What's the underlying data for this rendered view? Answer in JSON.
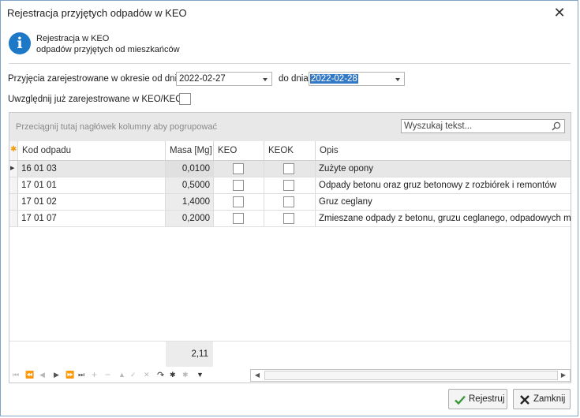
{
  "window": {
    "title": "Rejestracja przyjętych odpadów w KEO",
    "close_label": "✕"
  },
  "info": {
    "line1": "Rejestracja w KEO",
    "line2": "odpadów przyjętych od mieszkańców"
  },
  "filter": {
    "from_label": "Przyjęcia zarejestrowane w okresie od dnia",
    "from_value": "2022-02-27",
    "to_label": "do dnia",
    "to_value": "2022-02-28",
    "include_label": "Uwzględnij już zarejestrowane w KEO/KEOK",
    "include_checked": false
  },
  "grid": {
    "group_panel_text": "Przeciągnij tutaj nagłówek kolumny aby pogrupować",
    "search_placeholder": "Wyszukaj tekst...",
    "columns": [
      "Kod odpadu",
      "Masa [Mg]",
      "KEO",
      "KEOK",
      "Opis"
    ],
    "rows": [
      {
        "kod": "16 01 03",
        "masa": "0,0100",
        "keo": false,
        "keok": false,
        "opis": "Zużyte opony"
      },
      {
        "kod": "17 01 01",
        "masa": "0,5000",
        "keo": false,
        "keok": false,
        "opis": "Odpady betonu oraz gruz betonowy z rozbiórek i remontów"
      },
      {
        "kod": "17 01 02",
        "masa": "1,4000",
        "keo": false,
        "keok": false,
        "opis": "Gruz ceglany"
      },
      {
        "kod": "17 01 07",
        "masa": "0,2000",
        "keo": false,
        "keok": false,
        "opis": "Zmieszane odpady z betonu, gruzu ceglanego, odpadowych materiałów ceramicznych"
      }
    ],
    "selected_row": 0,
    "total_masa": "2,11"
  },
  "buttons": {
    "register": "Rejestruj",
    "close": "Zamknij"
  },
  "colors": {
    "accent": "#1e78c8",
    "selection": "#3178c6",
    "ok_green": "#3a9a3a",
    "cancel_dark": "#222222"
  }
}
